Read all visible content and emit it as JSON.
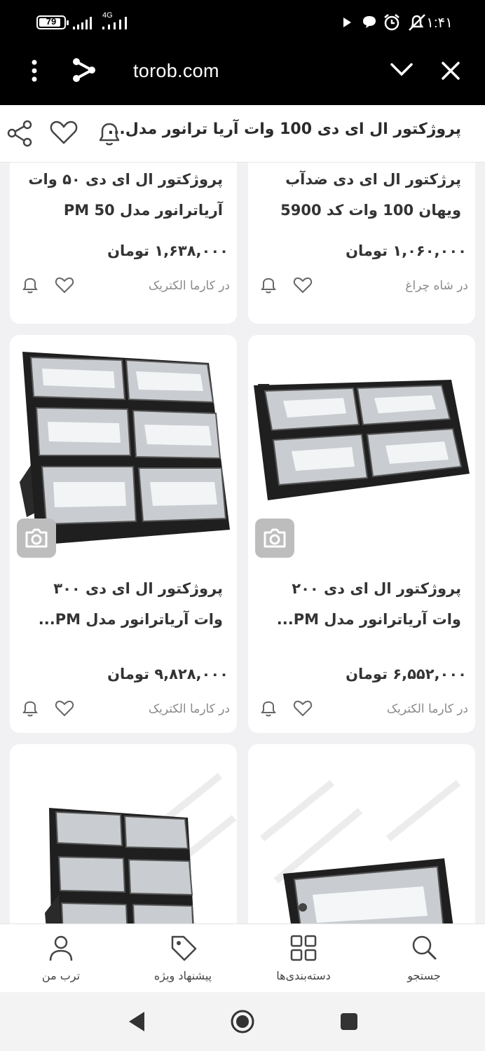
{
  "status_bar": {
    "battery": "79",
    "network": "4G",
    "time": "۱:۴۱"
  },
  "browser": {
    "url": "torob.com"
  },
  "header": {
    "title": "پروژکتور ال ای دی 100 وات آریا ترانور مدل..."
  },
  "cards": [
    {
      "name": "پرژکتور ال ای دی ضدآب ویهان 100 وات کد 5900",
      "price": "۱,۰۶۰,۰۰۰ تومان",
      "shop": "در شاه چراغ"
    },
    {
      "name": "پروژکتور ال ای دی ۵۰ وات آریاترانور مدل PM 50",
      "price": "۱,۶۳۸,۰۰۰ تومان",
      "shop": "در کارما الکتریک"
    },
    {
      "name": "پروژکتور ال ای دی ۲۰۰ وات آریاترانور مدل PM...",
      "price": "۶,۵۵۲,۰۰۰ تومان",
      "shop": "در کارما الکتریک"
    },
    {
      "name": "پروژکتور ال ای دی ۳۰۰ وات آریاترانور مدل PM...",
      "price": "۹,۸۲۸,۰۰۰ تومان",
      "shop": "در کارما الکتریک"
    }
  ],
  "bottom_nav": [
    {
      "label": "جستجو",
      "icon": "search-icon"
    },
    {
      "label": "دسته‌بندی‌ها",
      "icon": "grid-icon"
    },
    {
      "label": "پیشنهاد ویژه",
      "icon": "tag-icon"
    },
    {
      "label": "ترب من",
      "icon": "user-icon"
    }
  ]
}
